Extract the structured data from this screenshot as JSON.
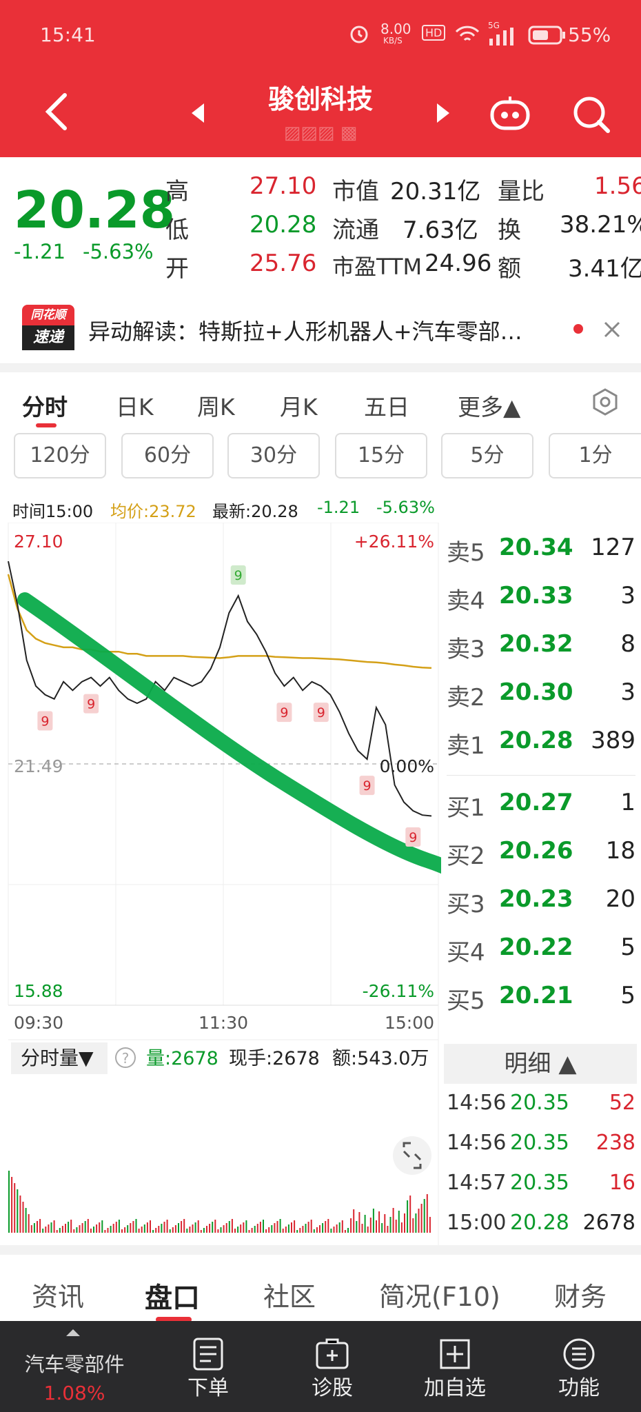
{
  "status": {
    "time": "15:41",
    "speed": "8.00",
    "speed_unit": "KB/S",
    "hd": "HD",
    "net": "5G",
    "battery": "55%"
  },
  "header": {
    "title": "骏创科技"
  },
  "quote": {
    "price": "20.28",
    "change": "-1.21",
    "change_pct": "-5.63%",
    "high_label": "高",
    "high": "27.10",
    "low_label": "低",
    "low": "20.28",
    "open_label": "开",
    "open": "25.76",
    "mcap_label": "市值",
    "mcap": "20.31亿",
    "float_label": "流通",
    "float": "7.63亿",
    "pe_label": "市盈TTM",
    "pe": "24.96",
    "vr_label": "量比",
    "vr": "1.56",
    "turn_label": "换",
    "turn": "38.21%",
    "amt_label": "额",
    "amt": "3.41亿"
  },
  "news": {
    "badge_top": "同花顺",
    "badge_bottom": "速递",
    "text": "异动解读：特斯拉+人形机器人+汽车零部…"
  },
  "period_tabs": [
    "分时",
    "日K",
    "周K",
    "月K",
    "五日",
    "更多▲"
  ],
  "interval_tabs": [
    "120分",
    "60分",
    "30分",
    "15分",
    "5分",
    "1分"
  ],
  "infobar": {
    "time": "时间15:00",
    "avg": "均价:23.72",
    "last": "最新:20.28",
    "chg": "-1.21",
    "pct": "-5.63%"
  },
  "chart_data": {
    "type": "line",
    "title": "",
    "x_ticks": [
      "09:30",
      "11:30",
      "15:00"
    ],
    "y_top": "27.10",
    "y_mid": "21.49",
    "y_bottom": "15.88",
    "pct_top": "+26.11%",
    "pct_mid": "0.00%",
    "pct_bottom": "-26.11%",
    "ylim": [
      15.88,
      27.1
    ],
    "base": 21.49,
    "price_series": [
      26.2,
      25.2,
      23.9,
      23.3,
      23.1,
      23.0,
      23.4,
      23.2,
      23.4,
      23.5,
      23.3,
      23.5,
      23.2,
      23.0,
      22.9,
      23.0,
      23.4,
      23.2,
      23.5,
      23.4,
      23.3,
      23.4,
      23.7,
      24.2,
      25.0,
      25.4,
      24.8,
      24.5,
      24.1,
      23.6,
      23.3,
      23.5,
      23.2,
      23.4,
      23.3,
      23.1,
      22.7,
      22.2,
      21.8,
      21.6,
      22.8,
      22.4,
      21.0,
      20.6,
      20.4,
      20.3,
      20.28
    ],
    "avg_series": [
      25.9,
      25.1,
      24.6,
      24.4,
      24.3,
      24.25,
      24.2,
      24.2,
      24.15,
      24.15,
      24.1,
      24.1,
      24.1,
      24.05,
      24.05,
      24.0,
      24.0,
      24.0,
      24.0,
      24.0,
      23.98,
      23.97,
      23.96,
      23.95,
      23.97,
      24.0,
      24.0,
      24.0,
      24.0,
      23.98,
      23.97,
      23.96,
      23.95,
      23.95,
      23.94,
      23.93,
      23.92,
      23.9,
      23.88,
      23.86,
      23.85,
      23.83,
      23.8,
      23.78,
      23.75,
      23.73,
      23.72
    ],
    "markers": [
      "9",
      "9",
      "9",
      "9",
      "9",
      "9",
      "9"
    ],
    "volume_label": "分时量▼",
    "volume_value": "量:2678",
    "volume_hand": "现手:2678",
    "volume_amt": "额:543.0万"
  },
  "order_book": {
    "sells": [
      {
        "label": "卖5",
        "price": "20.34",
        "vol": "127"
      },
      {
        "label": "卖4",
        "price": "20.33",
        "vol": "3"
      },
      {
        "label": "卖3",
        "price": "20.32",
        "vol": "8"
      },
      {
        "label": "卖2",
        "price": "20.30",
        "vol": "3"
      },
      {
        "label": "卖1",
        "price": "20.28",
        "vol": "389"
      }
    ],
    "buys": [
      {
        "label": "买1",
        "price": "20.27",
        "vol": "1"
      },
      {
        "label": "买2",
        "price": "20.26",
        "vol": "18"
      },
      {
        "label": "买3",
        "price": "20.23",
        "vol": "20"
      },
      {
        "label": "买4",
        "price": "20.22",
        "vol": "5"
      },
      {
        "label": "买5",
        "price": "20.21",
        "vol": "5"
      }
    ],
    "detail_label": "明细 ▲",
    "details": [
      {
        "t": "14:56",
        "p": "20.35",
        "v": "52"
      },
      {
        "t": "14:56",
        "p": "20.35",
        "v": "238"
      },
      {
        "t": "14:57",
        "p": "20.35",
        "v": "16"
      },
      {
        "t": "15:00",
        "p": "20.28",
        "v": "2678"
      }
    ]
  },
  "bottom_tabs": [
    "资讯",
    "盘口",
    "社区",
    "简况(F10)",
    "财务"
  ],
  "bottom_bar": {
    "sector": "汽车零部件",
    "sector_pct": "1.08%",
    "order": "下单",
    "diag": "诊股",
    "add": "加自选",
    "func": "功能"
  }
}
